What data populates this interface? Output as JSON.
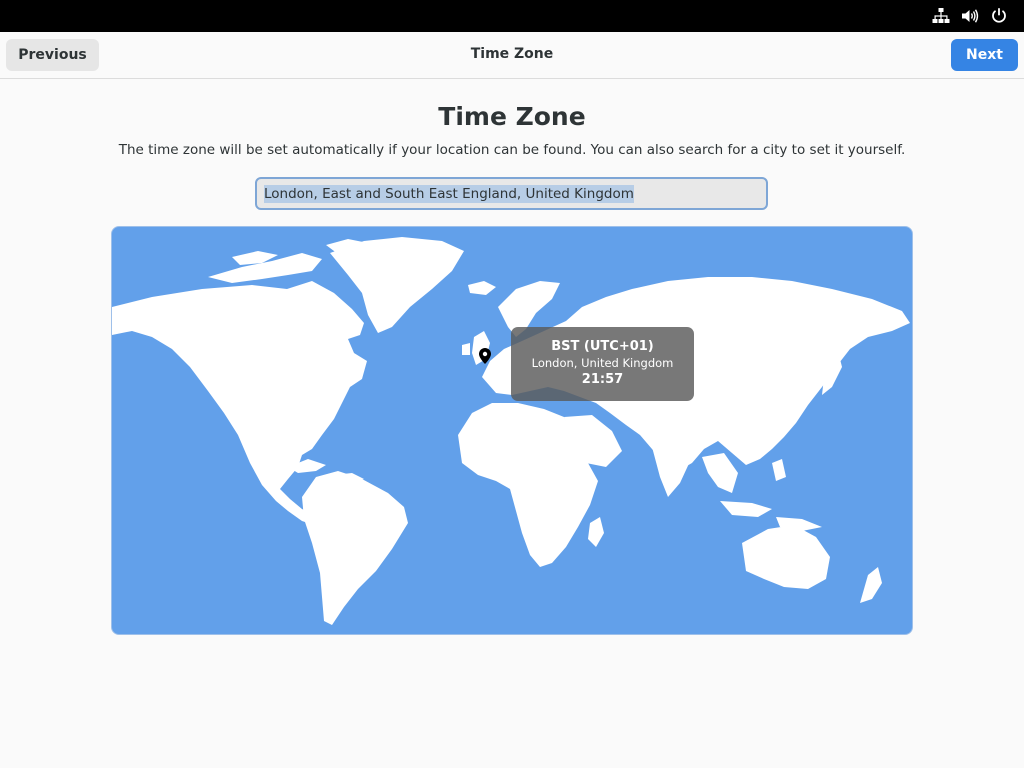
{
  "system_bar": {
    "icons": [
      "network-icon",
      "volume-icon",
      "power-icon"
    ]
  },
  "header": {
    "previous_label": "Previous",
    "title": "Time Zone",
    "next_label": "Next"
  },
  "page": {
    "title": "Time Zone",
    "description": "The time zone will be set automatically if your location can be found. You can also search for a city to set it yourself."
  },
  "search": {
    "value": "London, East and South East England, United Kingdom"
  },
  "map": {
    "tooltip": {
      "timezone": "BST (UTC+01)",
      "city": "London, United Kingdom",
      "time": "21:57"
    }
  },
  "colors": {
    "accent": "#3584e4",
    "ocean": "#62a0ea",
    "land": "#ffffff"
  }
}
